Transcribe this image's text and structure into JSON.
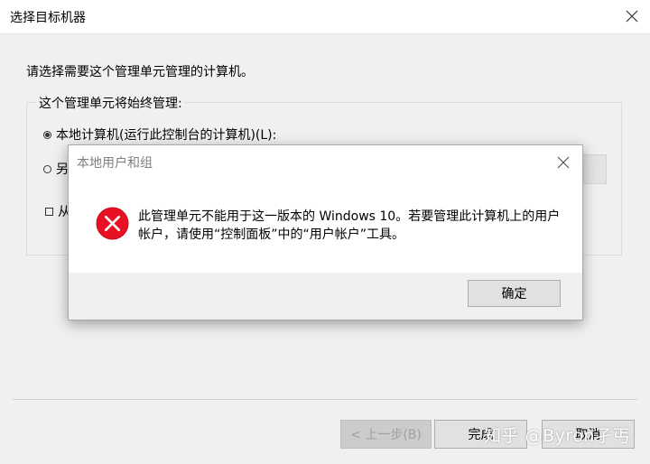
{
  "background_dialog": {
    "title": "选择目标机器",
    "prompt": "请选择需要这个管理单元管理的计算机。",
    "group_label": "这个管理单元将始终管理:",
    "option_local": "本地计算机(运行此控制台的计算机)(L):",
    "option_another": "另",
    "option_allow": "从",
    "selected_option": "option_local",
    "buttons": {
      "back": "< 上一步(B)",
      "finish": "完成",
      "cancel": "取消"
    }
  },
  "modal": {
    "title": "本地用户和组",
    "message": "此管理单元不能用于这一版本的 Windows 10。若要管理此计算机上的用户帐户，请使用“控制面板”中的“用户帐户”工具。",
    "ok_label": "确定",
    "icon": "error-icon",
    "icon_color": "#e81123"
  },
  "watermark": "知乎 @Byron孑丐"
}
